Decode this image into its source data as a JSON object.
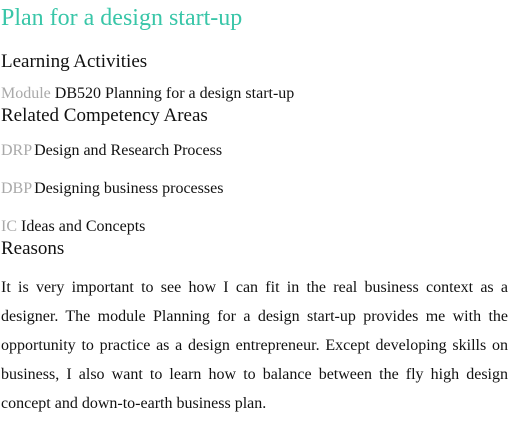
{
  "title": "Plan for a design start-up",
  "colors": {
    "title": "#39c6a8",
    "code_label": "#a9a9a9",
    "text": "#111111"
  },
  "learning_activities": {
    "heading": "Learning Activities",
    "items": [
      {
        "type": "Module",
        "text": "DB520 Planning for a design start-up"
      }
    ]
  },
  "competency_areas": {
    "heading": "Related Competency Areas",
    "items": [
      {
        "code": "DRP",
        "text": "Design and Research Process"
      },
      {
        "code": "DBP",
        "text": "Designing business processes"
      },
      {
        "code": "IC",
        "text": "Ideas and Concepts"
      }
    ]
  },
  "reasons": {
    "heading": "Reasons",
    "text": "It is very important to see how I can fit in the real business context as a designer. The module Planning for a design start-up provides me with the opportunity to practice as a design entrepreneur. Except developing skills on business, I also want to learn how to balance between the fly high design concept and down-to-earth business plan."
  }
}
